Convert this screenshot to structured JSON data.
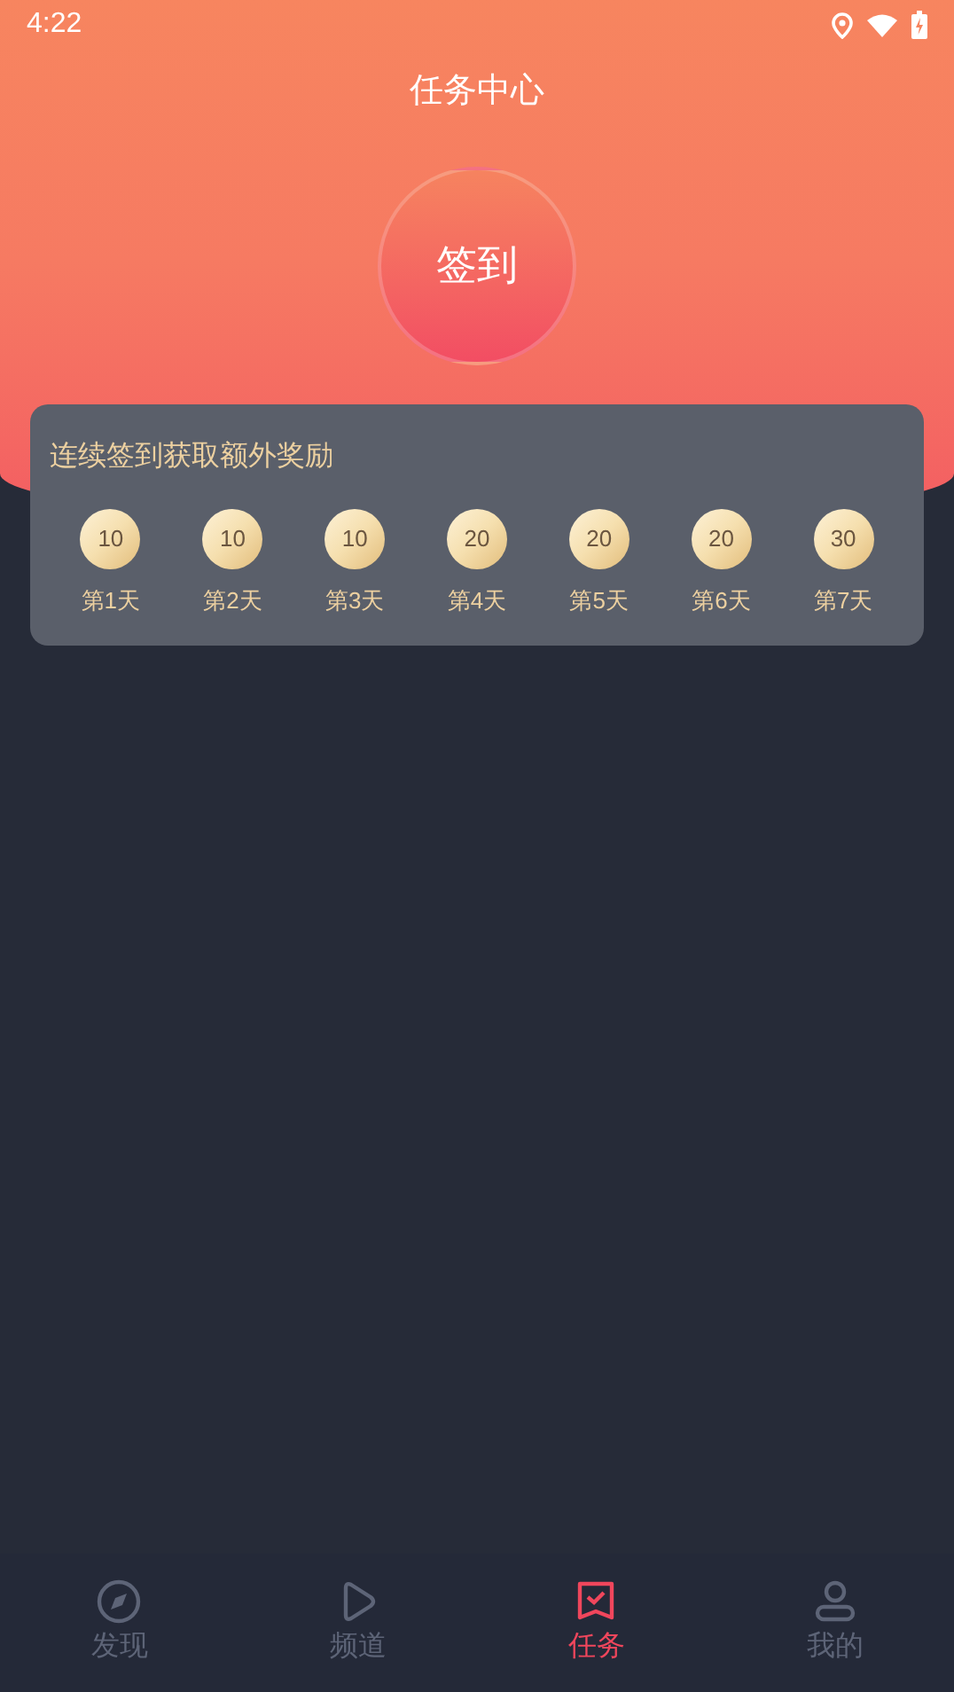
{
  "status_bar": {
    "time": "4:22"
  },
  "title": "任务中心",
  "checkin_button": "签到",
  "bonus_card": {
    "title": "连续签到获取额外奖励",
    "days": [
      {
        "reward": "10",
        "label": "第1天"
      },
      {
        "reward": "10",
        "label": "第2天"
      },
      {
        "reward": "10",
        "label": "第3天"
      },
      {
        "reward": "20",
        "label": "第4天"
      },
      {
        "reward": "20",
        "label": "第5天"
      },
      {
        "reward": "20",
        "label": "第6天"
      },
      {
        "reward": "30",
        "label": "第7天"
      }
    ]
  },
  "tabs": [
    {
      "label": "发现",
      "selected": false
    },
    {
      "label": "频道",
      "selected": false
    },
    {
      "label": "任务",
      "selected": true
    },
    {
      "label": "我的",
      "selected": false
    }
  ]
}
